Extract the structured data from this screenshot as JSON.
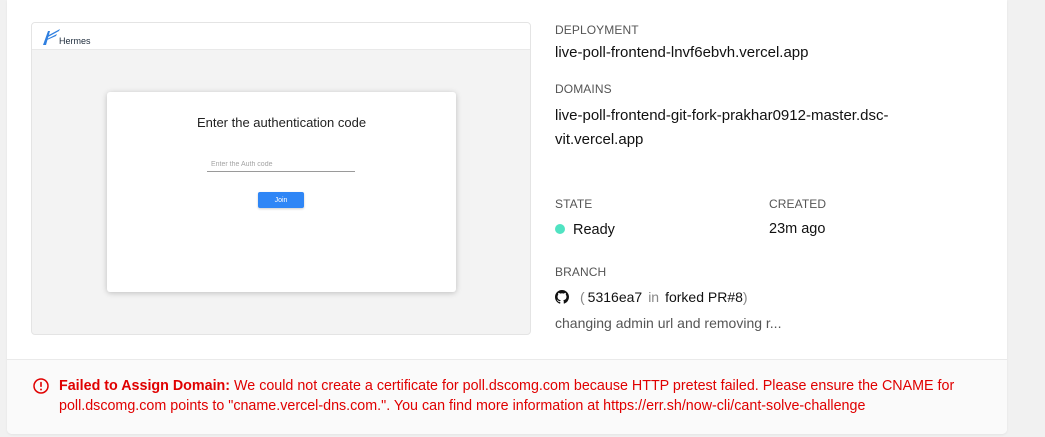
{
  "preview": {
    "brand": "Hermes",
    "modal_title": "Enter the authentication code",
    "auth_placeholder": "Enter the Auth code",
    "join_label": "Join"
  },
  "deployment": {
    "label": "DEPLOYMENT",
    "url": "live-poll-frontend-lnvf6ebvh.vercel.app"
  },
  "domains": {
    "label": "DOMAINS",
    "items": [
      "live-poll-frontend-git-fork-prakhar0912-master.dsc-vit.vercel.app"
    ]
  },
  "state": {
    "label": "STATE",
    "value": "Ready",
    "color": "#50e3c2"
  },
  "created": {
    "label": "CREATED",
    "value": "23m ago"
  },
  "branch": {
    "label": "BRANCH",
    "icon": "github-icon",
    "open_paren": "(",
    "commit": "5316ea7",
    "in": "in",
    "source": "forked PR#8",
    "close_paren": ")",
    "message": "changing admin url and removing r..."
  },
  "error": {
    "icon": "error-circle-icon",
    "color": "#e00000",
    "title": "Failed to Assign Domain:",
    "message": "We could not create a certificate for poll.dscomg.com because HTTP pretest failed. Please ensure the CNAME for poll.dscomg.com points to \"cname.vercel-dns.com.\". You can find more information at https://err.sh/now-cli/cant-solve-challenge"
  }
}
